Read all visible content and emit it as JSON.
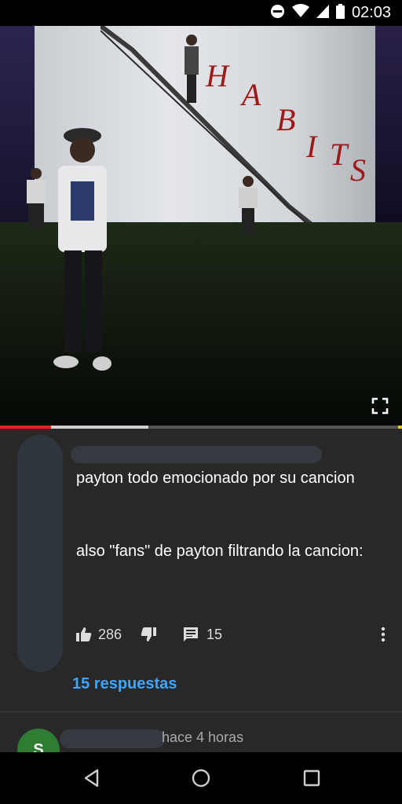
{
  "status_bar": {
    "time": "02:03",
    "icons": [
      "do-not-disturb-icon",
      "wifi-icon",
      "signal-icon",
      "battery-icon"
    ]
  },
  "video": {
    "wall_text": [
      "H",
      "A",
      "B",
      "I",
      "T",
      "S"
    ],
    "progress": {
      "played_fraction": 0.127,
      "buffered_fraction": 0.369
    },
    "fullscreen_icon": "fullscreen-icon"
  },
  "comment": {
    "text_line_1": "payton todo emocionado por su cancion",
    "text_line_2": "also \"fans\" de payton filtrando la cancion:",
    "likes": "286",
    "replies_count": "15",
    "replies_link": "15 respuestas",
    "icons": [
      "thumb-up-icon",
      "thumb-down-icon",
      "comment-icon",
      "more-vert-icon"
    ]
  },
  "next_comment": {
    "avatar_letter": "S",
    "time": "hace 4 horas"
  },
  "nav_bar": {
    "icons": [
      "back-icon",
      "home-icon",
      "recents-icon"
    ]
  },
  "colors": {
    "background": "#282828",
    "link": "#3ea6ff",
    "progress_played": "#e52222",
    "avatar_green": "#2e7d32"
  }
}
